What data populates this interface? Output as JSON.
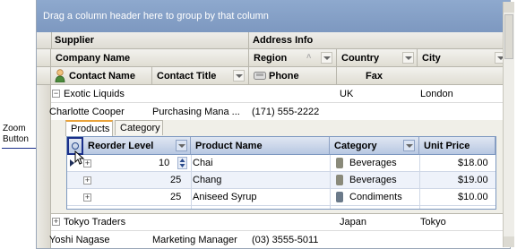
{
  "callout": {
    "label_line1": "Zoom",
    "label_line2": "Button"
  },
  "grid": {
    "group_panel_text": "Drag a column header here to group by that column",
    "bands": {
      "supplier": "Supplier",
      "address_info": "Address Info"
    },
    "header_row1": {
      "company_name": "Company Name",
      "region": "Region",
      "country": "Country",
      "city": "City"
    },
    "header_row2": {
      "contact_name": "Contact Name",
      "contact_title": "Contact Title",
      "phone": "Phone",
      "fax": "Fax"
    },
    "suppliers": [
      {
        "company": "Exotic Liquids",
        "country": "UK",
        "city": "London",
        "contact": "Charlotte Cooper",
        "title": "Purchasing  Mana ...",
        "phone": "(171) 555-2222",
        "fax": ""
      },
      {
        "company": "Tokyo Traders",
        "country": "Japan",
        "city": "Tokyo",
        "contact": "Yoshi Nagase",
        "title": "Marketing Manager",
        "phone": "(03) 3555-5011",
        "fax": ""
      }
    ],
    "detail": {
      "tabs": [
        "Products",
        "Category"
      ],
      "active_tab": "Products",
      "columns": {
        "reorder_level": "Reorder Level",
        "product_name": "Product Name",
        "category": "Category",
        "unit_price": "Unit Price"
      },
      "rows": [
        {
          "reorder": "10",
          "product": "Chai",
          "category": "Beverages",
          "price": "$18.00",
          "cat_color": "#8a8a7a"
        },
        {
          "reorder": "25",
          "product": "Chang",
          "category": "Beverages",
          "price": "$19.00",
          "cat_color": "#8a8a7a"
        },
        {
          "reorder": "25",
          "product": "Aniseed Syrup",
          "category": "Condiments",
          "price": "$10.00",
          "cat_color": "#6b7a8a"
        }
      ]
    }
  }
}
